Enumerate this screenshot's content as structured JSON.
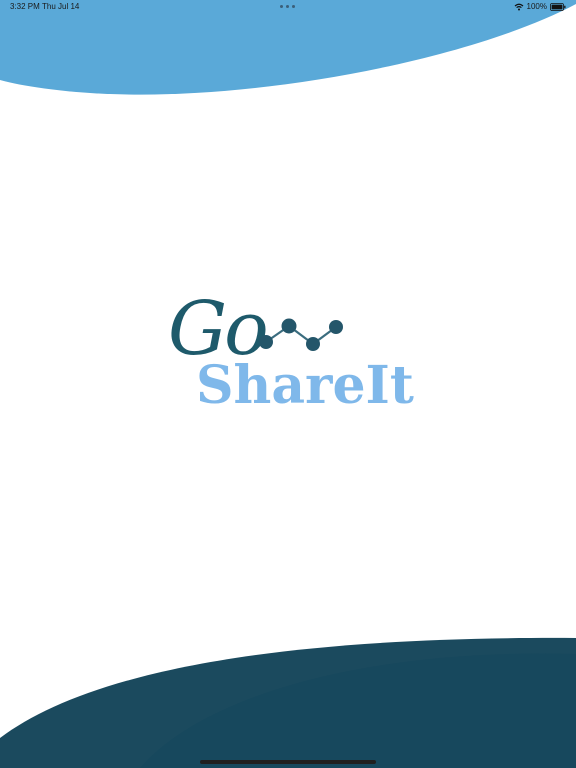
{
  "status_bar": {
    "time": "3:32 PM",
    "date": "Thu Jul 14",
    "battery_percent": "100%",
    "icons": [
      "wifi-icon",
      "battery-icon"
    ]
  },
  "logo": {
    "go_text": "Go",
    "shareit_text": "ShareIt",
    "icon": "molecule-icon"
  },
  "colors": {
    "top_wave": "#5aa9d8",
    "bottom_wave_dark": "#1b4a5e",
    "bottom_wave_mid": "#17485d",
    "logo_go": "#1e5a6b",
    "logo_shareit": "#7fb8ea",
    "background": "#ffffff"
  }
}
